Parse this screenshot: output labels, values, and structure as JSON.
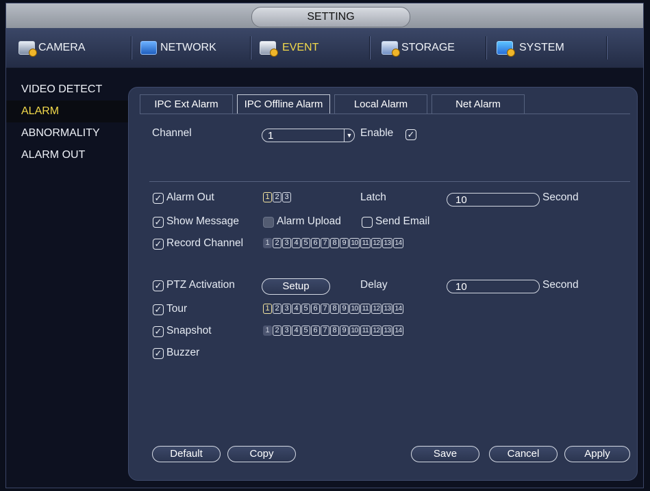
{
  "window": {
    "title": "SETTING"
  },
  "topnav": [
    {
      "label": "CAMERA",
      "icon": "camera-icon"
    },
    {
      "label": "NETWORK",
      "icon": "network-icon"
    },
    {
      "label": "EVENT",
      "icon": "event-icon"
    },
    {
      "label": "STORAGE",
      "icon": "storage-icon"
    },
    {
      "label": "SYSTEM",
      "icon": "system-icon"
    }
  ],
  "sidebar": {
    "items": [
      "VIDEO DETECT",
      "ALARM",
      "ABNORMALITY",
      "ALARM OUT"
    ],
    "active": "ALARM"
  },
  "tabs": [
    "IPC Ext Alarm",
    "IPC Offline Alarm",
    "Local Alarm",
    "Net Alarm"
  ],
  "active_tab": "IPC Offline Alarm",
  "form": {
    "channel_label": "Channel",
    "channel_value": "1",
    "enable_label": "Enable",
    "alarm_out_label": "Alarm Out",
    "alarm_out_numbers": [
      "1",
      "2",
      "3"
    ],
    "latch_label": "Latch",
    "latch_value": "10",
    "second_label": "Second",
    "show_message_label": "Show Message",
    "alarm_upload_label": "Alarm Upload",
    "send_email_label": "Send Email",
    "record_channel_label": "Record Channel",
    "channel_numbers": [
      "1",
      "2",
      "3",
      "4",
      "5",
      "6",
      "7",
      "8",
      "9",
      "10",
      "11",
      "12",
      "13",
      "14"
    ],
    "ptz_activation_label": "PTZ Activation",
    "setup_label": "Setup",
    "delay_label": "Delay",
    "delay_value": "10",
    "delay_second_label": "Second",
    "tour_label": "Tour",
    "snapshot_label": "Snapshot",
    "buzzer_label": "Buzzer"
  },
  "buttons": {
    "default": "Default",
    "copy": "Copy",
    "save": "Save",
    "cancel": "Cancel",
    "apply": "Apply"
  },
  "colors": {
    "active_text": "#f2d94b",
    "panel_bg": "#2b3550",
    "app_bg": "#0d1120"
  }
}
